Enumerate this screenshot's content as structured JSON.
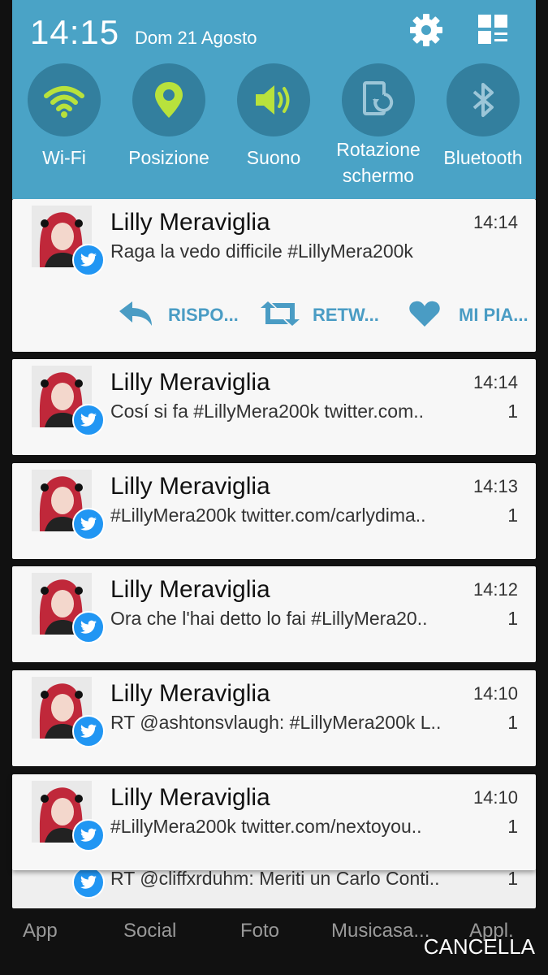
{
  "status": {
    "time": "14:15",
    "date": "Dom 21 Agosto"
  },
  "quick_settings": [
    {
      "label": "Wi-Fi",
      "icon": "wifi-icon"
    },
    {
      "label": "Posizione",
      "icon": "location-icon"
    },
    {
      "label": "Suono",
      "icon": "sound-icon"
    },
    {
      "label_line1": "Rotazione",
      "label_line2": "schermo",
      "icon": "rotation-icon"
    },
    {
      "label": "Bluetooth",
      "icon": "bluetooth-icon"
    }
  ],
  "notifications": [
    {
      "name": "Lilly Meraviglia",
      "time": "14:14",
      "message": "Raga la vedo difficile #LillyMera200k",
      "count": ""
    },
    {
      "name": "Lilly Meraviglia",
      "time": "14:14",
      "message": "Cosí si fa #LillyMera200k  twitter.com..",
      "count": "1"
    },
    {
      "name": "Lilly Meraviglia",
      "time": "14:13",
      "message": "#LillyMera200k  twitter.com/carlydima..",
      "count": "1"
    },
    {
      "name": "Lilly Meraviglia",
      "time": "14:12",
      "message": "Ora che l'hai detto lo fai #LillyMera20..",
      "count": "1"
    },
    {
      "name": "Lilly Meraviglia",
      "time": "14:10",
      "message": "RT @ashtonsvlaugh: #LillyMera200k L..",
      "count": "1"
    },
    {
      "name": "Lilly Meraviglia",
      "time": "14:10",
      "message": "#LillyMera200k  twitter.com/nextoyou..",
      "count": "1"
    },
    {
      "name": "",
      "time": "",
      "message": "RT @cliffxrduhm: Meriti un Carlo Conti..",
      "count": "1"
    }
  ],
  "actions": {
    "reply": "RISPO...",
    "retweet": "RETW...",
    "like": "MI PIA..."
  },
  "background_labels": [
    "App",
    "Social",
    "Foto",
    "Musicasa...",
    "Appl."
  ],
  "clear_button": "CANCELLA",
  "colors": {
    "panel": "#4aa3c6",
    "tile": "#337f9e",
    "active_icon": "#b8e23c",
    "twitter": "#2196f3"
  }
}
